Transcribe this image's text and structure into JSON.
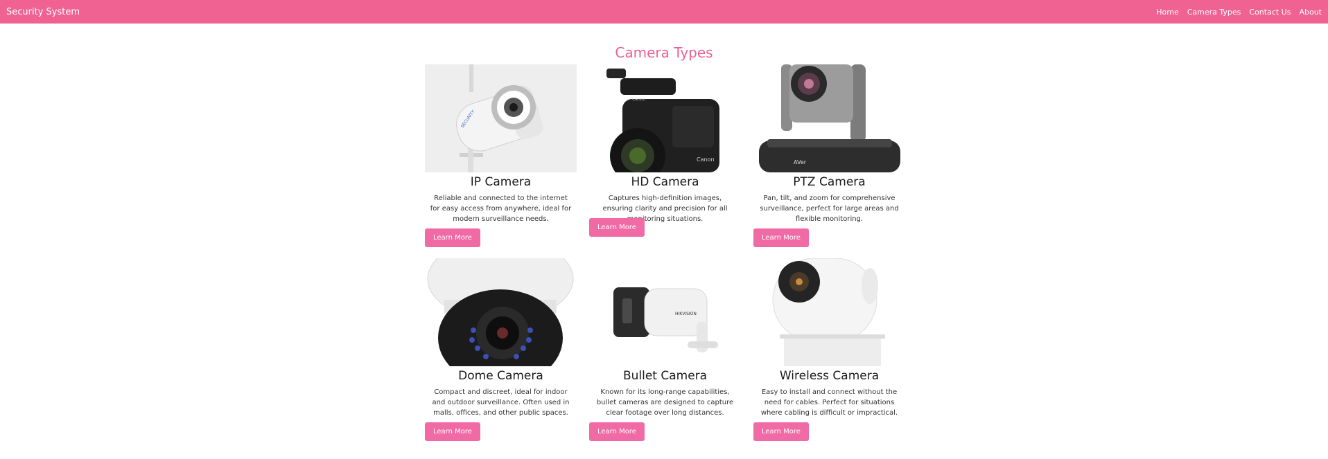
{
  "nav": {
    "brand": "Security System",
    "links": [
      "Home",
      "Camera Types",
      "Contact Us",
      "About"
    ]
  },
  "main": {
    "title": "Camera Types",
    "cards": [
      {
        "title": "IP Camera",
        "text": "Reliable and connected to the internet for easy access from anywhere, ideal for modern surveillance needs.",
        "button": "Learn More",
        "icon": "ip-camera-image"
      },
      {
        "title": "HD Camera",
        "text": "Captures high-definition images, ensuring clarity and precision for all monitoring situations.",
        "button": "Learn More",
        "icon": "hd-camera-image"
      },
      {
        "title": "PTZ Camera",
        "text": "Pan, tilt, and zoom for comprehensive surveillance, perfect for large areas and flexible monitoring.",
        "button": "Learn More",
        "icon": "ptz-camera-image"
      },
      {
        "title": "Dome Camera",
        "text": "Compact and discreet, ideal for indoor and outdoor surveillance. Often used in malls, offices, and other public spaces.",
        "button": "Learn More",
        "icon": "dome-camera-image"
      },
      {
        "title": "Bullet Camera",
        "text": "Known for its long-range capabilities, bullet cameras are designed to capture clear footage over long distances.",
        "button": "Learn More",
        "icon": "bullet-camera-image"
      },
      {
        "title": "Wireless Camera",
        "text": "Easy to install and connect without the need for cables. Perfect for situations where cabling is difficult or impractical.",
        "button": "Learn More",
        "icon": "wireless-camera-image"
      }
    ]
  },
  "colors": {
    "navbar": "#f06292",
    "title": "#ec5f92",
    "button": "#f06ba5"
  }
}
